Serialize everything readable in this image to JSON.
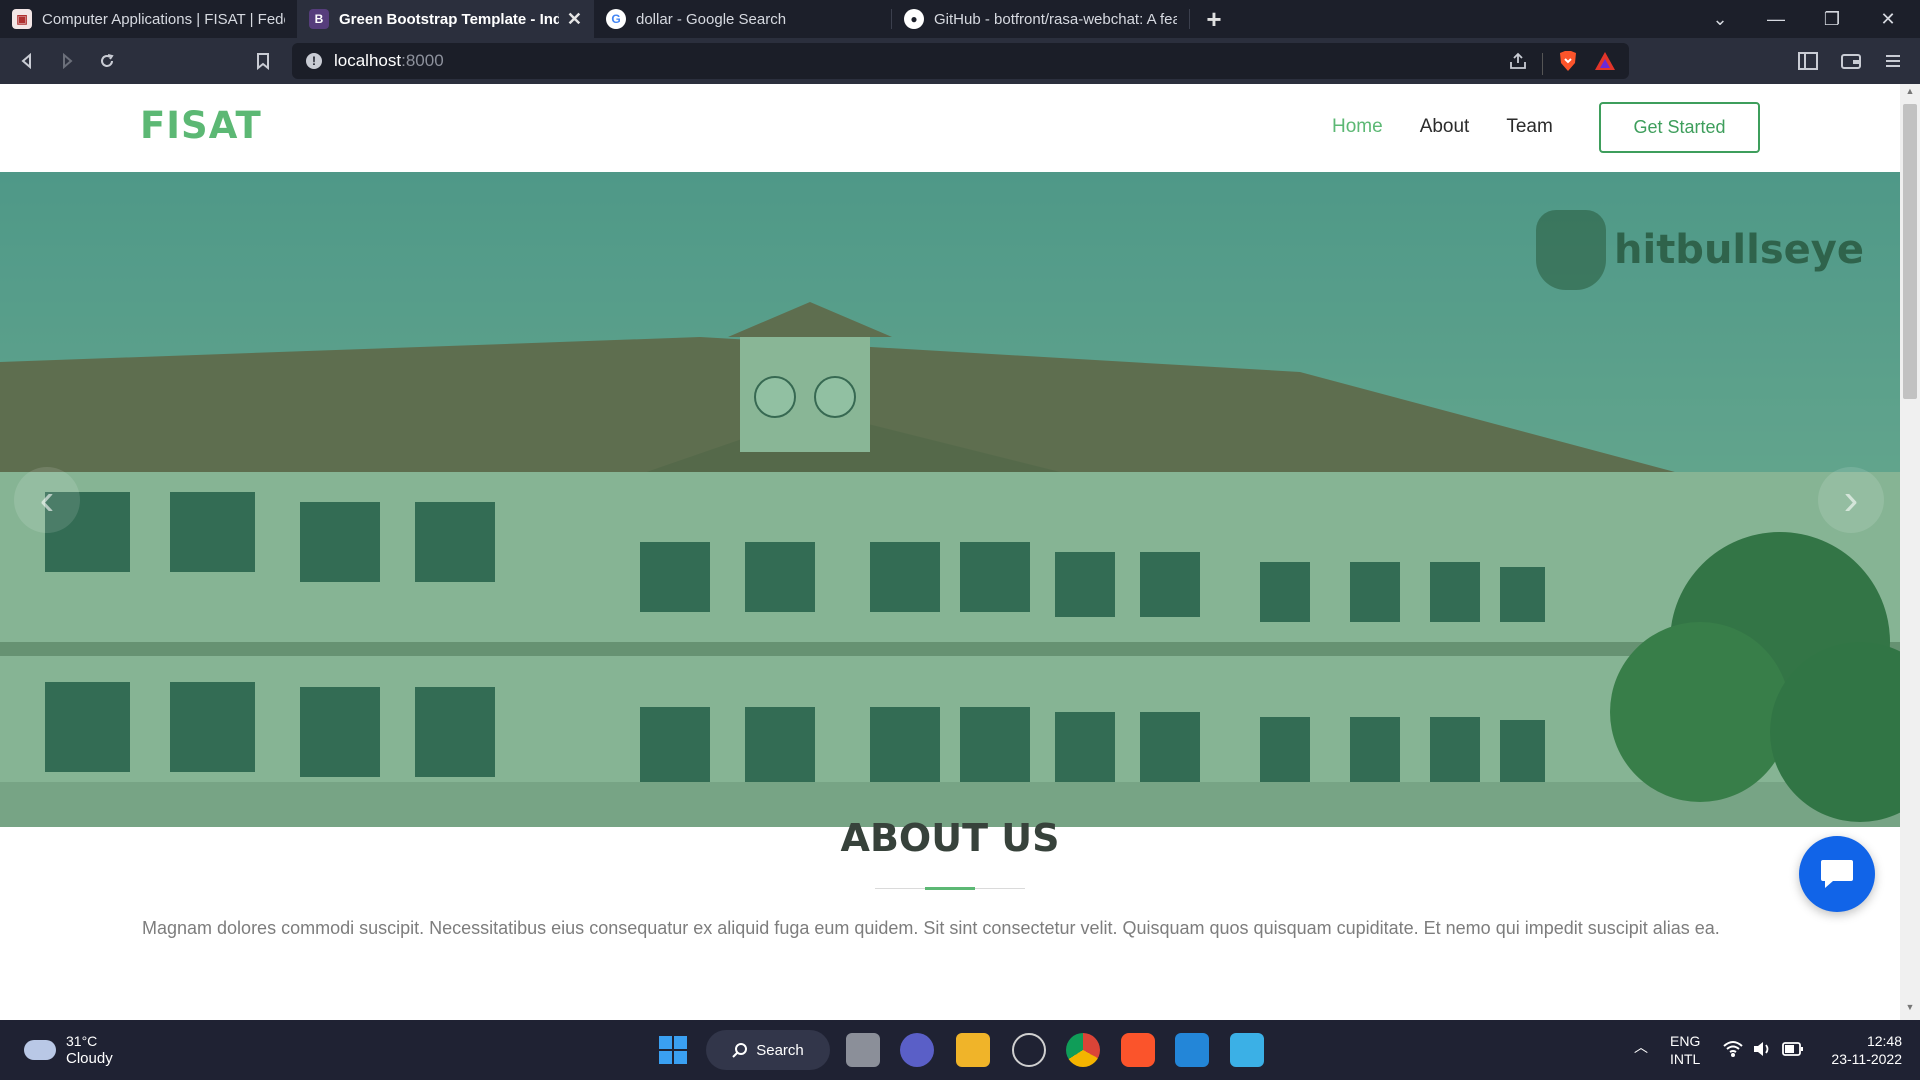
{
  "browser": {
    "tabs": [
      {
        "favicon": "fisat-favicon",
        "title": "Computer Applications | FISAT | Federa",
        "active": false
      },
      {
        "favicon": "bootstrap-favicon",
        "title": "Green Bootstrap Template - Index",
        "active": true
      },
      {
        "favicon": "google-favicon",
        "title": "dollar - Google Search",
        "active": false
      },
      {
        "favicon": "github-favicon",
        "title": "GitHub - botfront/rasa-webchat: A fea",
        "active": false
      }
    ],
    "url_host": "localhost",
    "url_port": ":8000"
  },
  "site": {
    "logo": "FISAT",
    "nav": [
      {
        "label": "Home",
        "active": true
      },
      {
        "label": "About",
        "active": false
      },
      {
        "label": "Team",
        "active": false
      }
    ],
    "cta": "Get Started",
    "hero_watermark": "hitbullseye",
    "about_title": "ABOUT US",
    "about_text": "Magnam dolores commodi suscipit. Necessitatibus eius consequatur ex aliquid fuga eum quidem. Sit sint consectetur velit. Quisquam quos quisquam cupiditate. Et nemo qui impedit suscipit alias ea."
  },
  "colors": {
    "accent": "#5cb874",
    "chat": "#1164e8"
  },
  "taskbar": {
    "temp": "31°C",
    "condition": "Cloudy",
    "search_label": "Search",
    "lang_top": "ENG",
    "lang_bottom": "INTL",
    "time": "12:48",
    "date": "23-11-2022"
  }
}
